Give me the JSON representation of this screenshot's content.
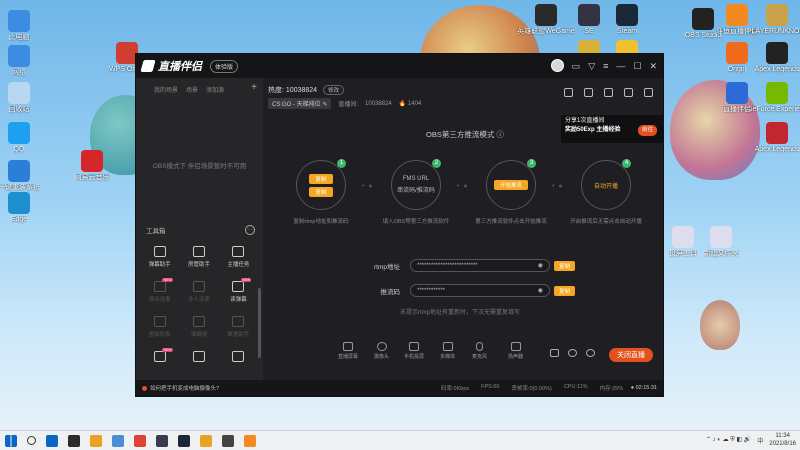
{
  "desktop": {
    "icons_left": [
      {
        "label": "此电脑",
        "color": "#3a8de0"
      },
      {
        "label": "网络",
        "color": "#3a8de0"
      },
      {
        "label": "回收站",
        "color": "#b9d7f0"
      },
      {
        "label": "QQ",
        "color": "#1ea0f0"
      },
      {
        "label": "一键重装系统",
        "color": "#2b7fd8"
      },
      {
        "label": "Edge",
        "color": "#1e90d0"
      }
    ],
    "icons_col2": [
      {
        "label": "WPS Office",
        "color": "#d23d32"
      },
      {
        "label": "网易云音乐",
        "color": "#d6262a"
      }
    ],
    "icons_top": [
      {
        "label": "英雄联盟WeGame",
        "color": "#2a2a2a"
      },
      {
        "label": "SE",
        "color": "#334"
      },
      {
        "label": "Steam",
        "color": "#1b2838"
      },
      {
        "label": "",
        "color": "#d6b23a"
      },
      {
        "label": "",
        "color": "#f0c030"
      }
    ],
    "icons_right": [
      {
        "label": "OBS Studio",
        "color": "#222"
      },
      {
        "label": "斗鱼直播伴侣",
        "color": "#f38a1f"
      },
      {
        "label": "PLAYERUNKNOWN'S BATTLEGROUNDS",
        "color": "#c9a24a"
      },
      {
        "label": "Origin",
        "color": "#f06a1b"
      },
      {
        "label": "Apex Legends",
        "color": "#222"
      },
      {
        "label": "GeForce Experience",
        "color": "#76b900"
      },
      {
        "label": "直播伴侣",
        "color": "#2c6ad8"
      },
      {
        "label": "Apex Legends",
        "color": "#c2262f"
      },
      {
        "label": "投屏工具",
        "color": "#dde"
      },
      {
        "label": "新建文件夹",
        "color": "#dde"
      }
    ]
  },
  "app": {
    "name": "直播伴侣",
    "version_pill": "体验版",
    "left_tabs": [
      "我的场景",
      "场景",
      "添加源"
    ],
    "left_empty_text": "OBS模式下  伴侣场景暂时不可用",
    "toolbox_title": "工具箱",
    "tools": [
      {
        "label": "弹幕助手",
        "dim": false,
        "badge": ""
      },
      {
        "label": "房管助手",
        "dim": false,
        "badge": ""
      },
      {
        "label": "主播任务",
        "dim": false,
        "badge": ""
      },
      {
        "label": "观众连麦",
        "dim": true,
        "badge": "NEW"
      },
      {
        "label": "多人连麦",
        "dim": true,
        "badge": ""
      },
      {
        "label": "读弹幕",
        "dim": false,
        "badge": "NEW"
      },
      {
        "label": "虚拟形象",
        "dim": true,
        "badge": ""
      },
      {
        "label": "弹幕墙",
        "dim": true,
        "badge": ""
      },
      {
        "label": "数据助手",
        "dim": true,
        "badge": ""
      },
      {
        "label": "",
        "dim": false,
        "badge": "NEW"
      },
      {
        "label": "",
        "dim": false,
        "badge": ""
      },
      {
        "label": "",
        "dim": false,
        "badge": ""
      }
    ],
    "hot_label": "热度:",
    "hot_value": "10038824",
    "edit_label": "修改",
    "game_tag": "CS:GO - 天梯排位",
    "room_label": "直播间:",
    "room_id": "10038824",
    "fans": "1404",
    "promo": {
      "line1": "分享1次直播间",
      "line2": "奖励50Exp 主播经验",
      "button": "前往"
    },
    "obs_title": "OBS第三方推流模式",
    "steps": [
      {
        "num": "1",
        "button": "复制",
        "button2": "复制",
        "desc": "复制rtmp地址和推流码"
      },
      {
        "num": "2",
        "line1": "FMS URL",
        "line2": "串流码/推流码",
        "desc": "填入OBS等第三方推流软件"
      },
      {
        "num": "3",
        "button": "开始推流",
        "desc": "第三方推流软件点击开始推流"
      },
      {
        "num": "4",
        "text": "自动开播",
        "desc": "开启推流后无需点击自动开播"
      }
    ],
    "rtmp_label": "rtmp地址",
    "rtmp_value": "**************************",
    "key_label": "推流码",
    "key_value": "************",
    "copy_label": "复制",
    "hint": "未提示rtmp地址有重新时，下次无需重复填写",
    "bottom_tools": [
      "直播屏幕",
      "摄像头",
      "手机投屏",
      "多媒体",
      "麦克风",
      "扬声器"
    ],
    "close_label": "关闭直播",
    "status_tip": "如何把手机变成电脑摄像头?",
    "stats": [
      "码率:0Kbps",
      "FPS:60",
      "丢帧率:0(0.00%)",
      "CPU:11%",
      "内存:25%"
    ],
    "elapsed": "02:15:31"
  },
  "taskbar": {
    "apps": [
      "#0a66c2",
      "#2b2b2b",
      "#e8a325",
      "#4a8ed8",
      "#db4437",
      "#3a3a50",
      "#1b2838",
      "#e8a325",
      "#444",
      "#f38a1f"
    ],
    "lang": "中",
    "time": "11:34",
    "date": "2021/8/16"
  },
  "colors": {
    "accent": "#f5a623",
    "danger": "#e5501f",
    "success": "#3cb96a"
  }
}
